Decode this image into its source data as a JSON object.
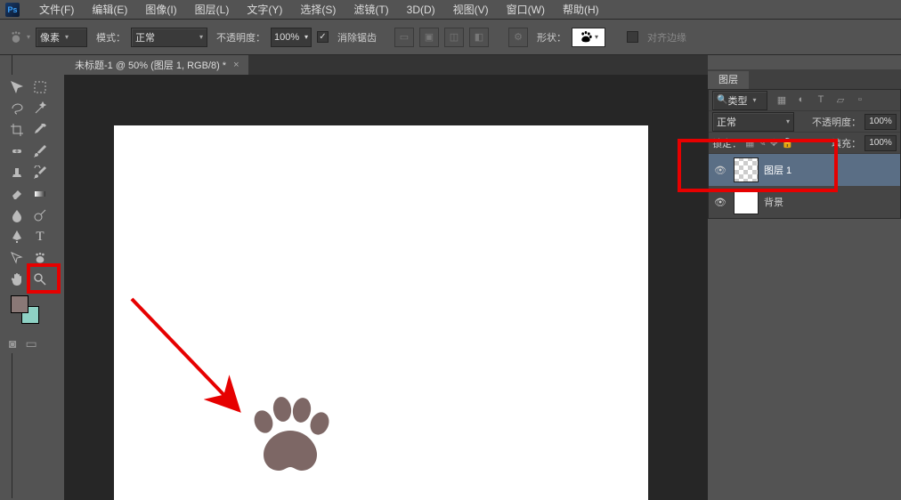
{
  "menu": [
    "文件(F)",
    "编辑(E)",
    "图像(I)",
    "图层(L)",
    "文字(Y)",
    "选择(S)",
    "滤镜(T)",
    "3D(D)",
    "视图(V)",
    "窗口(W)",
    "帮助(H)"
  ],
  "options": {
    "unit": "像素",
    "mode_label": "模式：",
    "mode": "正常",
    "opacity_label": "不透明度：",
    "opacity": "100%",
    "antialias": "消除锯齿",
    "shape_label": "形状：",
    "align": "对齐边缘"
  },
  "document": {
    "tab_title": "未标题-1 @ 50% (图层 1, RGB/8) *"
  },
  "panels": {
    "layers_tab": "图层",
    "filter_dropdown": "类型",
    "blend_mode": "正常",
    "opacity_label": "不透明度：",
    "opacity": "100%",
    "lock_label": "锁定：",
    "fill_label": "填充：",
    "fill": "100%",
    "layers": [
      {
        "name": "图层 1",
        "selected": true,
        "thumb": "trans"
      },
      {
        "name": "背景",
        "selected": false,
        "thumb": "white"
      }
    ]
  },
  "icons": {
    "check": "✓",
    "search": "🔍",
    "ps": "Ps"
  }
}
